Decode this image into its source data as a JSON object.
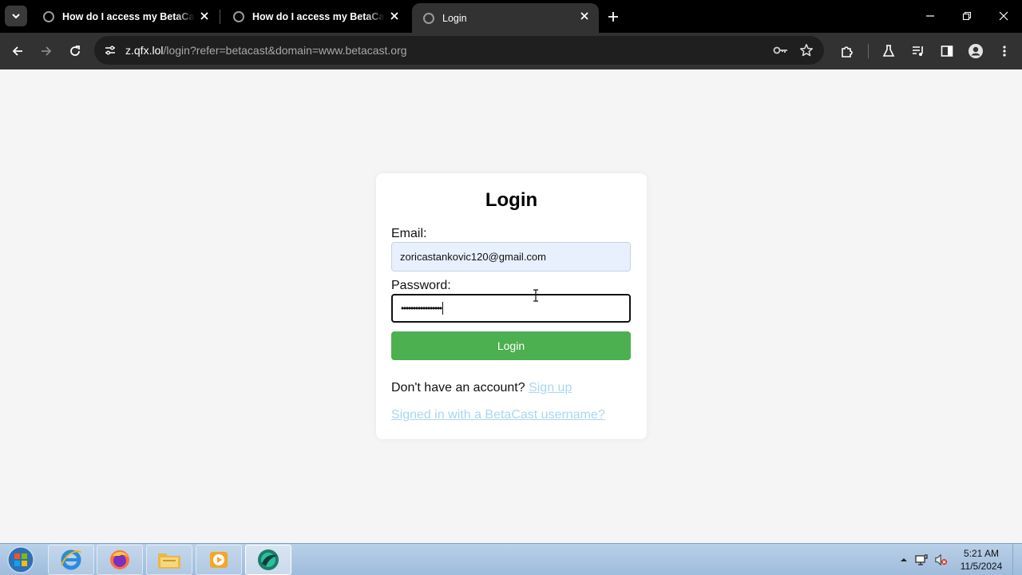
{
  "browser": {
    "tabs": [
      {
        "title": "How do I access my BetaCast c",
        "active": false
      },
      {
        "title": "How do I access my BetaCast c",
        "active": false
      },
      {
        "title": "Login",
        "active": true
      }
    ],
    "url": {
      "host": "z.qfx.lol",
      "path": "/login?refer=betacast&domain=www.betacast.org"
    }
  },
  "login": {
    "heading": "Login",
    "email_label": "Email:",
    "email_value": "zoricastankovic120@gmail.com",
    "password_label": "Password:",
    "password_masked": "•••••••••••••••••",
    "button_label": "Login",
    "signup_prompt": "Don't have an account?",
    "signup_link": "Sign up",
    "alt_link": "Signed in with a BetaCast username?"
  },
  "colors": {
    "button": "#4caf50",
    "link": "#a9d7f0",
    "email_autofill_bg": "#e8f0fe"
  },
  "taskbar": {
    "apps": [
      "internet-explorer",
      "firefox",
      "file-explorer",
      "media-player",
      "app-browser"
    ],
    "time": "5:21 AM",
    "date": "11/5/2024"
  }
}
